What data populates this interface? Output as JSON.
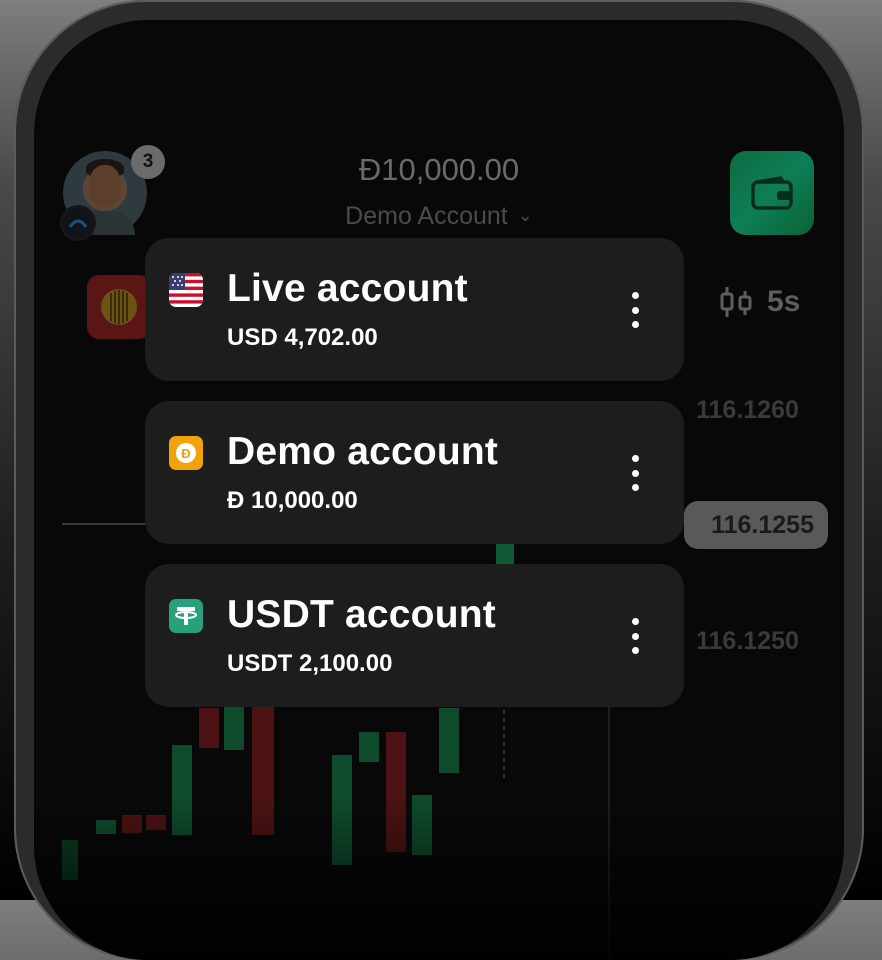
{
  "header": {
    "notification_count": "3",
    "balance": "Đ10,000.00",
    "account_selector": "Demo Account",
    "timeframe": "5s"
  },
  "chart": {
    "price_labels": [
      "116.1260",
      "116.1255",
      "116.1250"
    ],
    "current_price": "116.1255"
  },
  "accounts": [
    {
      "name": "Live account",
      "balance": "USD 4,702.00",
      "icon": "us-flag-icon",
      "color": "#b22234"
    },
    {
      "name": "Demo account",
      "balance": "Đ 10,000.00",
      "icon": "demo-coin-icon",
      "color": "#f0a30a"
    },
    {
      "name": "USDT account",
      "balance": "USDT 2,100.00",
      "icon": "tether-icon",
      "color": "#26a17b"
    }
  ],
  "colors": {
    "card_bg": "#1d1d1d",
    "wallet_green": "#0d7f55",
    "candle_up": "#0e5a36",
    "candle_down": "#5a1414"
  }
}
